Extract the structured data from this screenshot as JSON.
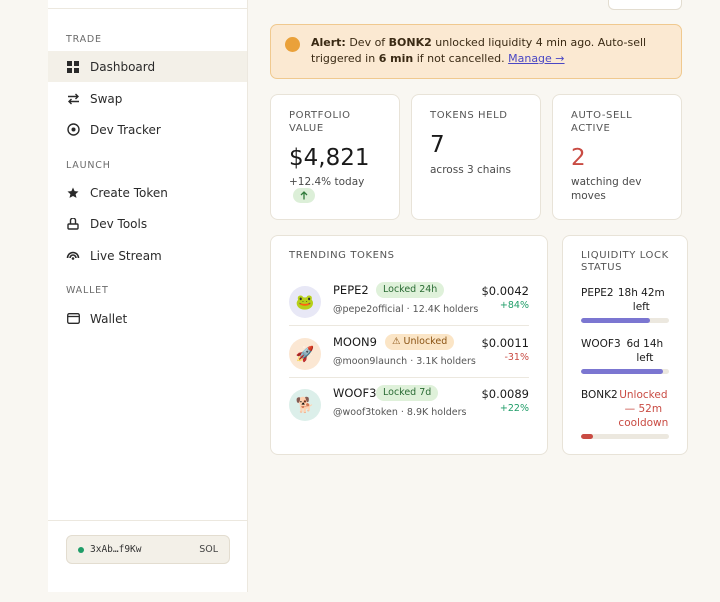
{
  "sidebar": {
    "sections": {
      "trade": "TRADE",
      "launch": "LAUNCH",
      "wallet": "WALLET"
    },
    "items": {
      "dashboard": "Dashboard",
      "swap": "Swap",
      "dev_tracker": "Dev Tracker",
      "create_token": "Create Token",
      "dev_tools": "Dev Tools",
      "live_stream": "Live Stream",
      "wallet": "Wallet"
    },
    "wallet_pill": {
      "address": "3xAb…f9Kw",
      "chain": "SOL",
      "status_color": "#1f9d68"
    }
  },
  "alert": {
    "label": "Alert:",
    "text_1": " Dev of ",
    "token": "BONK2",
    "text_2": " unlocked liquidity 4 min ago. Auto-sell triggered in ",
    "time": "6 min",
    "text_3": " if not cancelled. ",
    "link": "Manage →"
  },
  "stats": {
    "portfolio": {
      "label": "PORTFOLIO VALUE",
      "value": "$4,821",
      "sub": "+12.4% today",
      "trend_icon": "arrow-up-icon"
    },
    "tokens_held": {
      "label": "TOKENS HELD",
      "value": "7",
      "sub": "across 3 chains"
    },
    "auto_sell": {
      "label": "AUTO-SELL ACTIVE",
      "value": "2",
      "sub": "watching dev moves",
      "value_color": "#c94b43"
    }
  },
  "trending": {
    "title": "TRENDING TOKENS",
    "rows": [
      {
        "name": "PEPE2",
        "badge": "Locked 24h",
        "badge_type": "locked",
        "meta": "@pepe2official · 12.4K holders",
        "price": "$0.0042",
        "change": "+84%",
        "dir": "pos",
        "avatar": "🐸",
        "avatar_bg": "#e8e8f6"
      },
      {
        "name": "MOON9",
        "badge": "⚠ Unlocked",
        "badge_type": "unlocked",
        "meta": "@moon9launch · 3.1K holders",
        "price": "$0.0011",
        "change": "-31%",
        "dir": "neg",
        "avatar": "🚀",
        "avatar_bg": "#fbe7d3"
      },
      {
        "name": "WOOF3",
        "badge": "Locked 7d",
        "badge_type": "locked",
        "meta": "@woof3token · 8.9K holders",
        "price": "$0.0089",
        "change": "+22%",
        "dir": "pos",
        "avatar": "🐕",
        "avatar_bg": "#dcefea"
      }
    ]
  },
  "liquidity": {
    "title": "LIQUIDITY LOCK STATUS",
    "items": [
      {
        "name": "PEPE2",
        "status": "18h 42m left",
        "progress": 0.78,
        "color": "#7b76d1",
        "status_color": "#1a1a1a"
      },
      {
        "name": "WOOF3",
        "status": "6d 14h left",
        "progress": 0.93,
        "color": "#7b76d1",
        "status_color": "#1a1a1a"
      },
      {
        "name": "BONK2",
        "status": "Unlocked — 52m cooldown",
        "progress": 0.14,
        "color": "#c94b43",
        "status_color": "#c94b43"
      }
    ]
  }
}
